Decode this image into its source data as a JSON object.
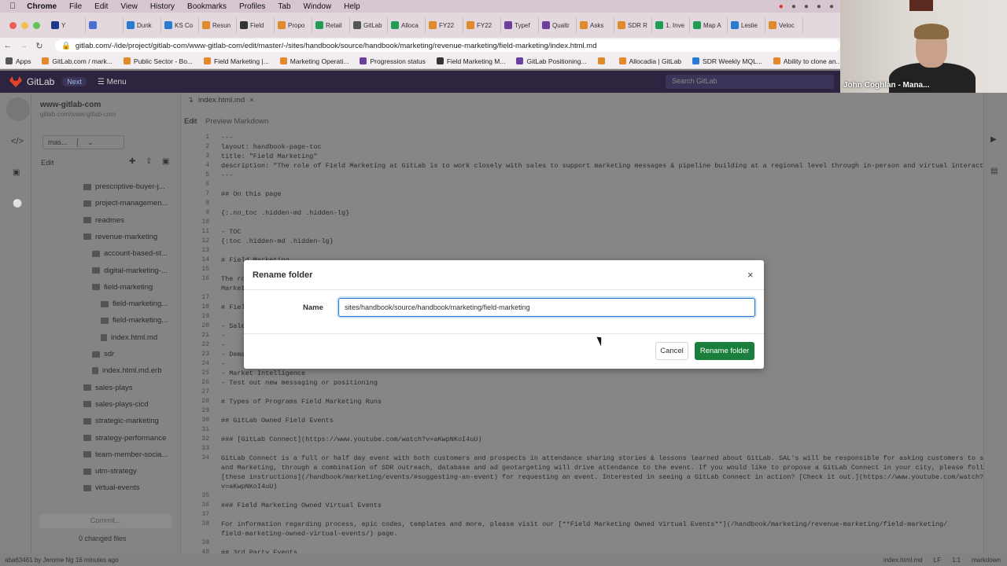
{
  "menubar": {
    "apple": "",
    "items": [
      "Chrome",
      "File",
      "Edit",
      "View",
      "History",
      "Bookmarks",
      "Profiles",
      "Tab",
      "Window",
      "Help"
    ]
  },
  "tabs": [
    {
      "label": "Y",
      "color": "#1b3a8a"
    },
    {
      "label": "",
      "color": "#4a6fd6"
    },
    {
      "label": "Dunk",
      "color": "#2b7bd6"
    },
    {
      "label": "KS Co",
      "color": "#2b7bd6"
    },
    {
      "label": "Resun",
      "color": "#e28a2a"
    },
    {
      "label": "Field",
      "color": "#333"
    },
    {
      "label": "Propo",
      "color": "#e28a2a"
    },
    {
      "label": "Retail",
      "color": "#1f9d55"
    },
    {
      "label": "GitLab",
      "color": "#555"
    },
    {
      "label": "Alloca",
      "color": "#1f9d55"
    },
    {
      "label": "FY22",
      "color": "#e28a2a"
    },
    {
      "label": "FY22",
      "color": "#e28a2a"
    },
    {
      "label": "Typef",
      "color": "#6b3fa0"
    },
    {
      "label": "Qualtr",
      "color": "#6b3fa0"
    },
    {
      "label": "Asks",
      "color": "#e28a2a"
    },
    {
      "label": "SDR R",
      "color": "#e28a2a"
    },
    {
      "label": "1. Inve",
      "color": "#1f9d55"
    },
    {
      "label": "Map A",
      "color": "#1f9d55"
    },
    {
      "label": "Leslie",
      "color": "#2b7bd6"
    },
    {
      "label": "Veloc",
      "color": "#e28a2a"
    }
  ],
  "address": {
    "url": "gitlab.com/-/ide/project/gitlab-com/www-gitlab-com/edit/master/-/sites/handbook/source/handbook/marketing/revenue-marketing/field-marketing/index.html.md"
  },
  "bookmarks": [
    {
      "label": "Apps",
      "color": "#555"
    },
    {
      "label": "GitLab.com / mark...",
      "color": "#e28a2a"
    },
    {
      "label": "Public Sector - Bo...",
      "color": "#e28a2a"
    },
    {
      "label": "Field Marketing |...",
      "color": "#e28a2a"
    },
    {
      "label": "Marketing Operati...",
      "color": "#e28a2a"
    },
    {
      "label": "Progression status",
      "color": "#6b3fa0"
    },
    {
      "label": "Field Marketing M...",
      "color": "#333"
    },
    {
      "label": "GitLab Positioning...",
      "color": "#6b3fa0"
    },
    {
      "label": "",
      "color": "#e28a2a"
    },
    {
      "label": "Allocadia | GitLab",
      "color": "#e28a2a"
    },
    {
      "label": "SDR Weekly MQL...",
      "color": "#2b7bd6"
    },
    {
      "label": "Ability to clone an...",
      "color": "#e28a2a"
    }
  ],
  "gitlab_nav": {
    "brand": "GitLab",
    "next": "Next",
    "menu": "Menu",
    "search_placeholder": "Search GitLab"
  },
  "webcam": {
    "name": "John Coghlan - Mana..."
  },
  "project": {
    "name": "www-gitlab-com",
    "path": "gitlab-com/www-gitlab-com",
    "branch": "mas...",
    "edit": "Edit"
  },
  "tree": [
    {
      "label": "prescriptive-buyer-j...",
      "type": "folder",
      "indent": 0
    },
    {
      "label": "project-managemen...",
      "type": "folder",
      "indent": 0
    },
    {
      "label": "readmes",
      "type": "folder",
      "indent": 0
    },
    {
      "label": "revenue-marketing",
      "type": "folder",
      "indent": 0
    },
    {
      "label": "account-based-st...",
      "type": "folder",
      "indent": 1
    },
    {
      "label": "digital-marketing-...",
      "type": "folder",
      "indent": 1
    },
    {
      "label": "field-marketing",
      "type": "folder",
      "indent": 1
    },
    {
      "label": "field-marketing...",
      "type": "folder",
      "indent": 2
    },
    {
      "label": "field-marketing...",
      "type": "folder",
      "indent": 2
    },
    {
      "label": "index.html.md",
      "type": "file",
      "indent": 2
    },
    {
      "label": "sdr",
      "type": "folder",
      "indent": 1
    },
    {
      "label": "index.html.md.erb",
      "type": "file",
      "indent": 1
    },
    {
      "label": "sales-plays",
      "type": "folder",
      "indent": 0
    },
    {
      "label": "sales-plays-cicd",
      "type": "folder",
      "indent": 0
    },
    {
      "label": "strategic-marketing",
      "type": "folder",
      "indent": 0
    },
    {
      "label": "strategy-performance",
      "type": "folder",
      "indent": 0
    },
    {
      "label": "team-member-socia...",
      "type": "folder",
      "indent": 0
    },
    {
      "label": "utm-strategy",
      "type": "folder",
      "indent": 0
    },
    {
      "label": "virtual-events",
      "type": "folder",
      "indent": 0
    }
  ],
  "sidebar_footer": {
    "commit": "Commit...",
    "changed": "0 changed files"
  },
  "editor": {
    "file_tab": "index.html.md",
    "mode_edit": "Edit",
    "mode_preview": "Preview Markdown",
    "lines": [
      {
        "n": "1",
        "t": "---"
      },
      {
        "n": "2",
        "t": "layout: handbook-page-toc"
      },
      {
        "n": "3",
        "t": "title: \"Field Marketing\""
      },
      {
        "n": "4",
        "t": "description: \"The role of Field Marketing at GitLab is to work closely with sales to support marketing messages & pipeline building at a regional level through in-person and virtual interactions.\""
      },
      {
        "n": "5",
        "t": "---"
      },
      {
        "n": "6",
        "t": ""
      },
      {
        "n": "7",
        "t": "## On this page"
      },
      {
        "n": "8",
        "t": ""
      },
      {
        "n": "9",
        "t": "{:.no_toc .hidden-md .hidden-lg}"
      },
      {
        "n": "10",
        "t": ""
      },
      {
        "n": "11",
        "t": "- TOC"
      },
      {
        "n": "12",
        "t": "{:toc .hidden-md .hidden-lg}"
      },
      {
        "n": "13",
        "t": ""
      },
      {
        "n": "14",
        "t": "# Field Marketing"
      },
      {
        "n": "15",
        "t": ""
      },
      {
        "n": "16",
        "t": "The ro                                                                                         ty) coupled with multi-touch activities. Field"
      },
      {
        "n": "",
        "t": "Market                                                                                          g pipeline through the funnel more quickly."
      },
      {
        "n": "17",
        "t": ""
      },
      {
        "n": "18",
        "t": "# Fiel"
      },
      {
        "n": "19",
        "t": ""
      },
      {
        "n": "20",
        "t": "- Sale"
      },
      {
        "n": "21",
        "t": "   -"
      },
      {
        "n": "22",
        "t": "   -"
      },
      {
        "n": "23",
        "t": "- Dema"
      },
      {
        "n": "24",
        "t": "   -"
      },
      {
        "n": "25",
        "t": "- Market Intelligence"
      },
      {
        "n": "26",
        "t": "    - Test out new messaging or positioning"
      },
      {
        "n": "27",
        "t": ""
      },
      {
        "n": "28",
        "t": "# Types of Programs Field Marketing Runs"
      },
      {
        "n": "29",
        "t": ""
      },
      {
        "n": "30",
        "t": "## GitLab Owned Field Events"
      },
      {
        "n": "31",
        "t": ""
      },
      {
        "n": "32",
        "t": "### [GitLab Connect](https://www.youtube.com/watch?v=aKwpNKoI4uU)"
      },
      {
        "n": "33",
        "t": ""
      },
      {
        "n": "34",
        "t": "GitLab Connect is a full or half day event with both customers and prospects in attendance sharing stories & lessons learned about GitLab. SAL's will be responsible for asking customers to speak"
      },
      {
        "n": "",
        "t": "and Marketing, through a combination of SDR outreach, database and ad geotargeting will drive attendance to the event. If you would like to propose a GitLab Connect in your city, please follow"
      },
      {
        "n": "",
        "t": "[these instructions](/handbook/marketing/events/#suggesting-an-event) for requesting an event. Interested in seeing a GitLab Connect in action? [Check it out.](https://www.youtube.com/watch?"
      },
      {
        "n": "",
        "t": "v=aKwpNKoI4uU)"
      },
      {
        "n": "35",
        "t": ""
      },
      {
        "n": "36",
        "t": "### Field Marketing Owned Virtual Events"
      },
      {
        "n": "37",
        "t": ""
      },
      {
        "n": "38",
        "t": "For information regarding process, epic codes, templates and more, please visit our [**Field Marketing Owned Virtual Events**](/handbook/marketing/revenue-marketing/field-marketing/"
      },
      {
        "n": "",
        "t": "field-marketing-owned-virtual-events/) page."
      },
      {
        "n": "39",
        "t": ""
      },
      {
        "n": "40",
        "t": "## 3rd Party Events"
      }
    ]
  },
  "statusbar": {
    "left": "aba63461 by   Jerome Ng 16 minutes ago",
    "file": "index.html.md",
    "eol": "LF",
    "pos": "1:1",
    "lang": "markdown"
  },
  "modal": {
    "title": "Rename folder",
    "name_label": "Name",
    "name_value": "sites/handbook/source/handbook/marketing/field-marketing",
    "cancel": "Cancel",
    "confirm": "Rename folder"
  }
}
